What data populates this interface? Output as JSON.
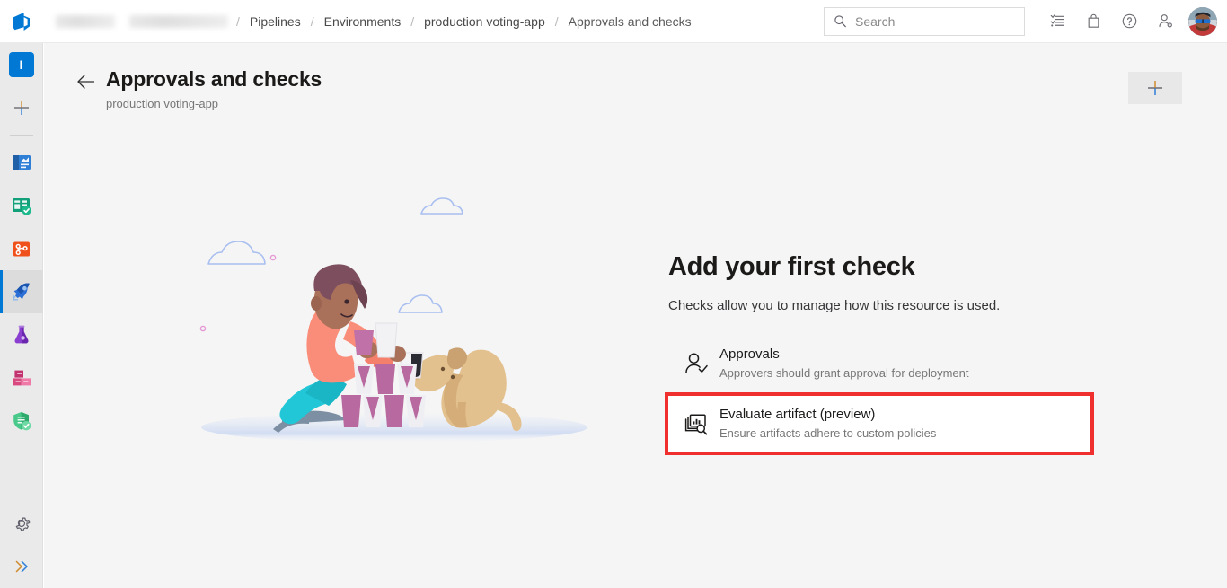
{
  "header": {
    "logo_icon": "azure-devops-logo",
    "org_name_redacted": true,
    "project_name_redacted": true,
    "breadcrumbs": [
      {
        "label": "Pipelines"
      },
      {
        "label": "Environments"
      },
      {
        "label": "production voting-app"
      },
      {
        "label": "Approvals and checks"
      }
    ],
    "separator": "/",
    "search": {
      "placeholder": "Search",
      "value": "",
      "icon": "search-icon"
    },
    "icons": [
      {
        "name": "task-list-icon",
        "glyph": "list"
      },
      {
        "name": "marketplace-bag-icon",
        "glyph": "bag"
      },
      {
        "name": "help-question-icon",
        "glyph": "question"
      },
      {
        "name": "user-settings-icon",
        "glyph": "person-gear"
      }
    ],
    "avatar_label": "User profile"
  },
  "sidebar": {
    "project_tile": {
      "label": "I",
      "color": "#0078d4",
      "name": "project-avatar"
    },
    "items": [
      {
        "name": "new-item-button",
        "icon": "plus-icon",
        "label": "New",
        "active": false
      },
      {
        "name": "sidebar-item-overview",
        "icon": "overview-icon",
        "label": "Overview",
        "active": false
      },
      {
        "name": "sidebar-item-boards",
        "icon": "boards-icon",
        "label": "Boards",
        "active": false
      },
      {
        "name": "sidebar-item-repos",
        "icon": "repos-icon",
        "label": "Repos",
        "active": false
      },
      {
        "name": "sidebar-item-pipelines",
        "icon": "pipelines-rocket-icon",
        "label": "Pipelines",
        "active": true
      },
      {
        "name": "sidebar-item-test-plans",
        "icon": "test-plans-flask-icon",
        "label": "Test Plans",
        "active": false
      },
      {
        "name": "sidebar-item-artifacts",
        "icon": "artifacts-boxes-icon",
        "label": "Artifacts",
        "active": false
      },
      {
        "name": "sidebar-item-security",
        "icon": "security-shield-icon",
        "label": "Security",
        "active": false
      }
    ],
    "bottom_items": [
      {
        "name": "project-settings-button",
        "icon": "gear-icon",
        "label": "Project settings"
      },
      {
        "name": "expand-rail-button",
        "icon": "double-chevron-right-icon",
        "label": "Expand"
      }
    ]
  },
  "page": {
    "back_label": "Back",
    "title": "Approvals and checks",
    "subtitle": "production voting-app",
    "add_button_label": "+",
    "add_button_name": "add-check-button"
  },
  "empty_state": {
    "illustration_name": "person-stacking-cups-with-dog-illustration",
    "heading": "Add your first check",
    "description": "Checks allow you to manage how this resource is used.",
    "options": [
      {
        "title": "Approvals",
        "description": "Approvers should grant approval for deployment",
        "icon": "person-check-icon",
        "highlighted": false
      },
      {
        "title": "Evaluate artifact (preview)",
        "description": "Ensure artifacts adhere to custom policies",
        "icon": "evaluate-artifact-icon",
        "highlighted": true
      }
    ]
  },
  "colors": {
    "accent": "#0078d4",
    "highlight_box": "#f0302f",
    "page_background": "#f5f5f5",
    "rail_background": "#eaeaea"
  }
}
